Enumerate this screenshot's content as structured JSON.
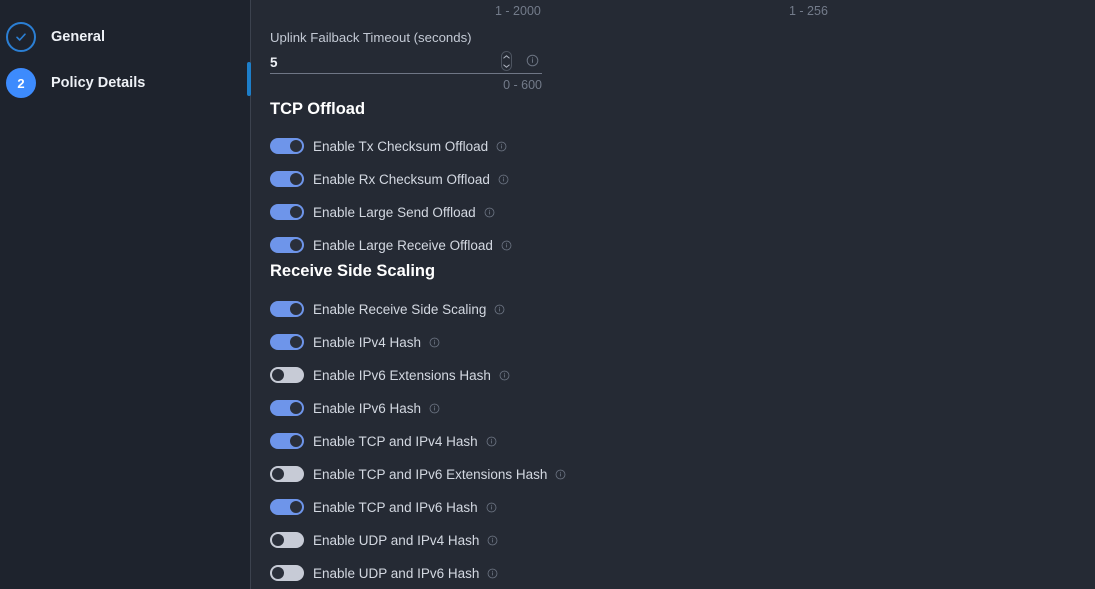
{
  "steps_panel": {
    "steps": [
      {
        "label": "General",
        "state": "completed",
        "marker_icon": "check-circle-icon",
        "number": ""
      },
      {
        "label": "Policy Details",
        "state": "active",
        "marker_icon": "step-number-badge",
        "number": "2"
      }
    ]
  },
  "content": {
    "range_hints_top": [
      "1 - 2000",
      "1 - 256"
    ],
    "timeout_field": {
      "label": "Uplink Failback Timeout (seconds)",
      "value": "5",
      "range_hint": "0 - 600",
      "spinner_icon": "number-spinner-icon",
      "info_icon": "info-icon"
    },
    "sections": [
      {
        "title": "TCP Offload",
        "toggles": [
          {
            "label": "Enable Tx Checksum Offload",
            "on": true
          },
          {
            "label": "Enable Rx Checksum Offload",
            "on": true
          },
          {
            "label": "Enable Large Send Offload",
            "on": true
          },
          {
            "label": "Enable Large Receive Offload",
            "on": true
          }
        ]
      },
      {
        "title": "Receive Side Scaling",
        "toggles": [
          {
            "label": "Enable Receive Side Scaling",
            "on": true
          },
          {
            "label": "Enable IPv4 Hash",
            "on": true
          },
          {
            "label": "Enable IPv6 Extensions Hash",
            "on": false
          },
          {
            "label": "Enable IPv6 Hash",
            "on": true
          },
          {
            "label": "Enable TCP and IPv4 Hash",
            "on": true
          },
          {
            "label": "Enable TCP and IPv6 Extensions Hash",
            "on": false
          },
          {
            "label": "Enable TCP and IPv6 Hash",
            "on": true
          },
          {
            "label": "Enable UDP and IPv4 Hash",
            "on": false
          },
          {
            "label": "Enable UDP and IPv6 Hash",
            "on": false
          }
        ]
      }
    ],
    "colors": {
      "toggle_on": "#6e95ea",
      "toggle_off": "#c7cbd6",
      "accent_blue": "#3d8bfd",
      "scrollbar": "#1d7ec9",
      "panel_bg": "#252a34",
      "sidebar_bg": "#1e232d"
    }
  }
}
